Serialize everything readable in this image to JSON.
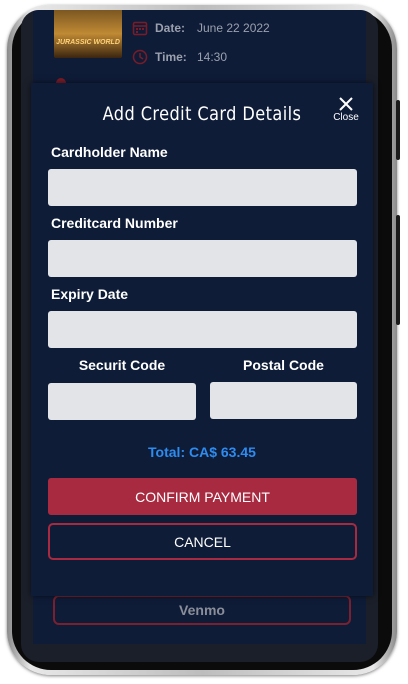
{
  "background": {
    "poster_text": "JURASSIC WORLD",
    "date_label": "Date:",
    "date_value": "June 22 2022",
    "time_label": "Time:",
    "time_value": "14:30",
    "venmo_label": "Venmo"
  },
  "modal": {
    "title": "Add Credit Card Details",
    "close_label": "Close",
    "cardholder_label": "Cardholder Name",
    "cardholder_value": "",
    "cardnumber_label": "Creditcard Number",
    "cardnumber_value": "",
    "expiry_label": "Expiry Date",
    "expiry_value": "",
    "security_label": "Securit Code",
    "security_value": "",
    "postal_label": "Postal Code",
    "postal_value": "",
    "total": "Total: CA$ 63.45",
    "confirm_label": "CONFIRM PAYMENT",
    "cancel_label": "CANCEL"
  },
  "colors": {
    "app_background": "#0f1c38",
    "accent": "#a82a40",
    "total_text": "#2d8cf0",
    "input_background": "#e3e4e8"
  },
  "icons": [
    "calendar-icon",
    "clock-icon",
    "close-icon"
  ]
}
